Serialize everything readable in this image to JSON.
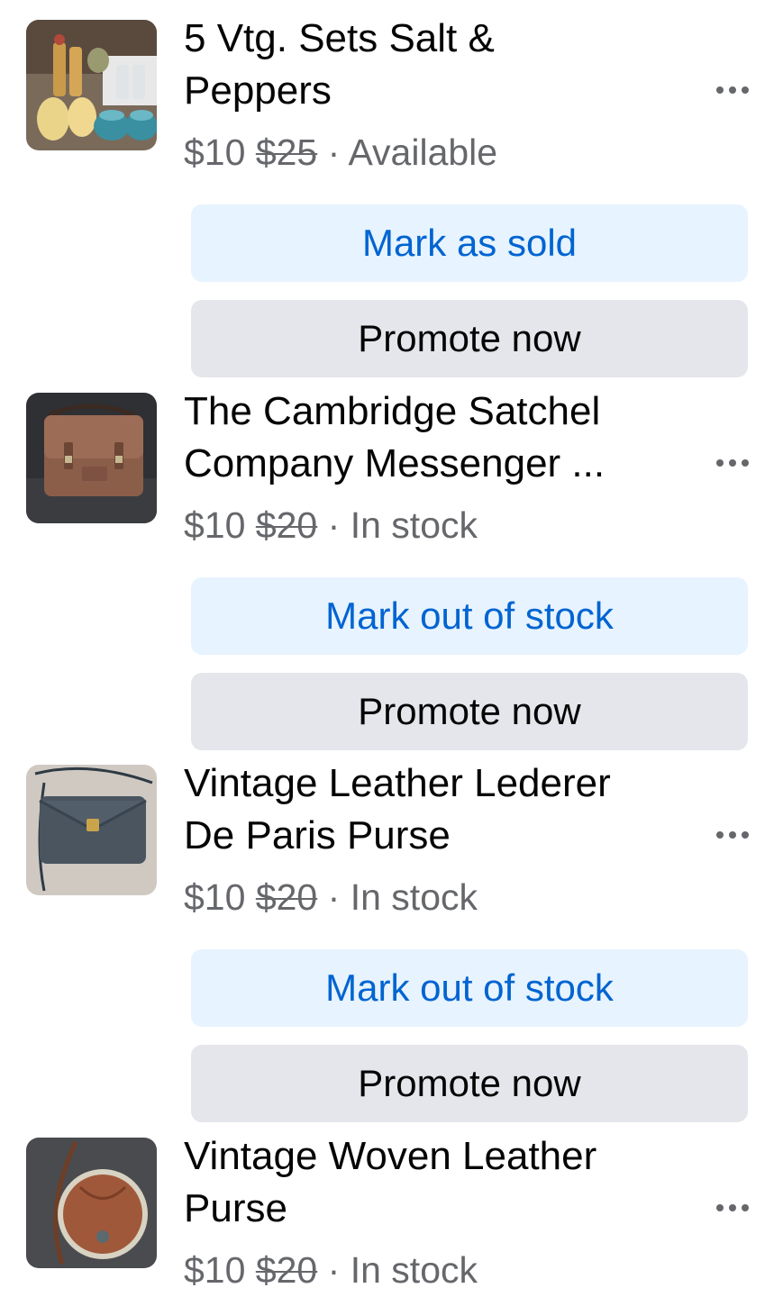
{
  "listings": [
    {
      "title_line1": "5 Vtg. Sets Salt &",
      "title_line2": "Peppers",
      "price": "$10",
      "original_price": "$25",
      "separator": "·",
      "status": "Available",
      "primary_action": "Mark as sold",
      "secondary_action": "Promote now"
    },
    {
      "title_line1": "The Cambridge Satchel",
      "title_line2": "Company Messenger ...",
      "price": "$10",
      "original_price": "$20",
      "separator": "·",
      "status": "In stock",
      "primary_action": "Mark out of stock",
      "secondary_action": "Promote now"
    },
    {
      "title_line1": "Vintage Leather Lederer",
      "title_line2": "De Paris Purse",
      "price": "$10",
      "original_price": "$20",
      "separator": "·",
      "status": "In stock",
      "primary_action": "Mark out of stock",
      "secondary_action": "Promote now"
    },
    {
      "title_line1": "Vintage Woven Leather",
      "title_line2": "Purse",
      "price": "$10",
      "original_price": "$20",
      "separator": "·",
      "status": "In stock"
    }
  ],
  "icons": {
    "more": "more-options-icon"
  },
  "colors": {
    "primary_button_bg": "#e7f3ff",
    "primary_button_text": "#0064d1",
    "secondary_button_bg": "#e4e6eb",
    "muted_text": "#65676b"
  }
}
